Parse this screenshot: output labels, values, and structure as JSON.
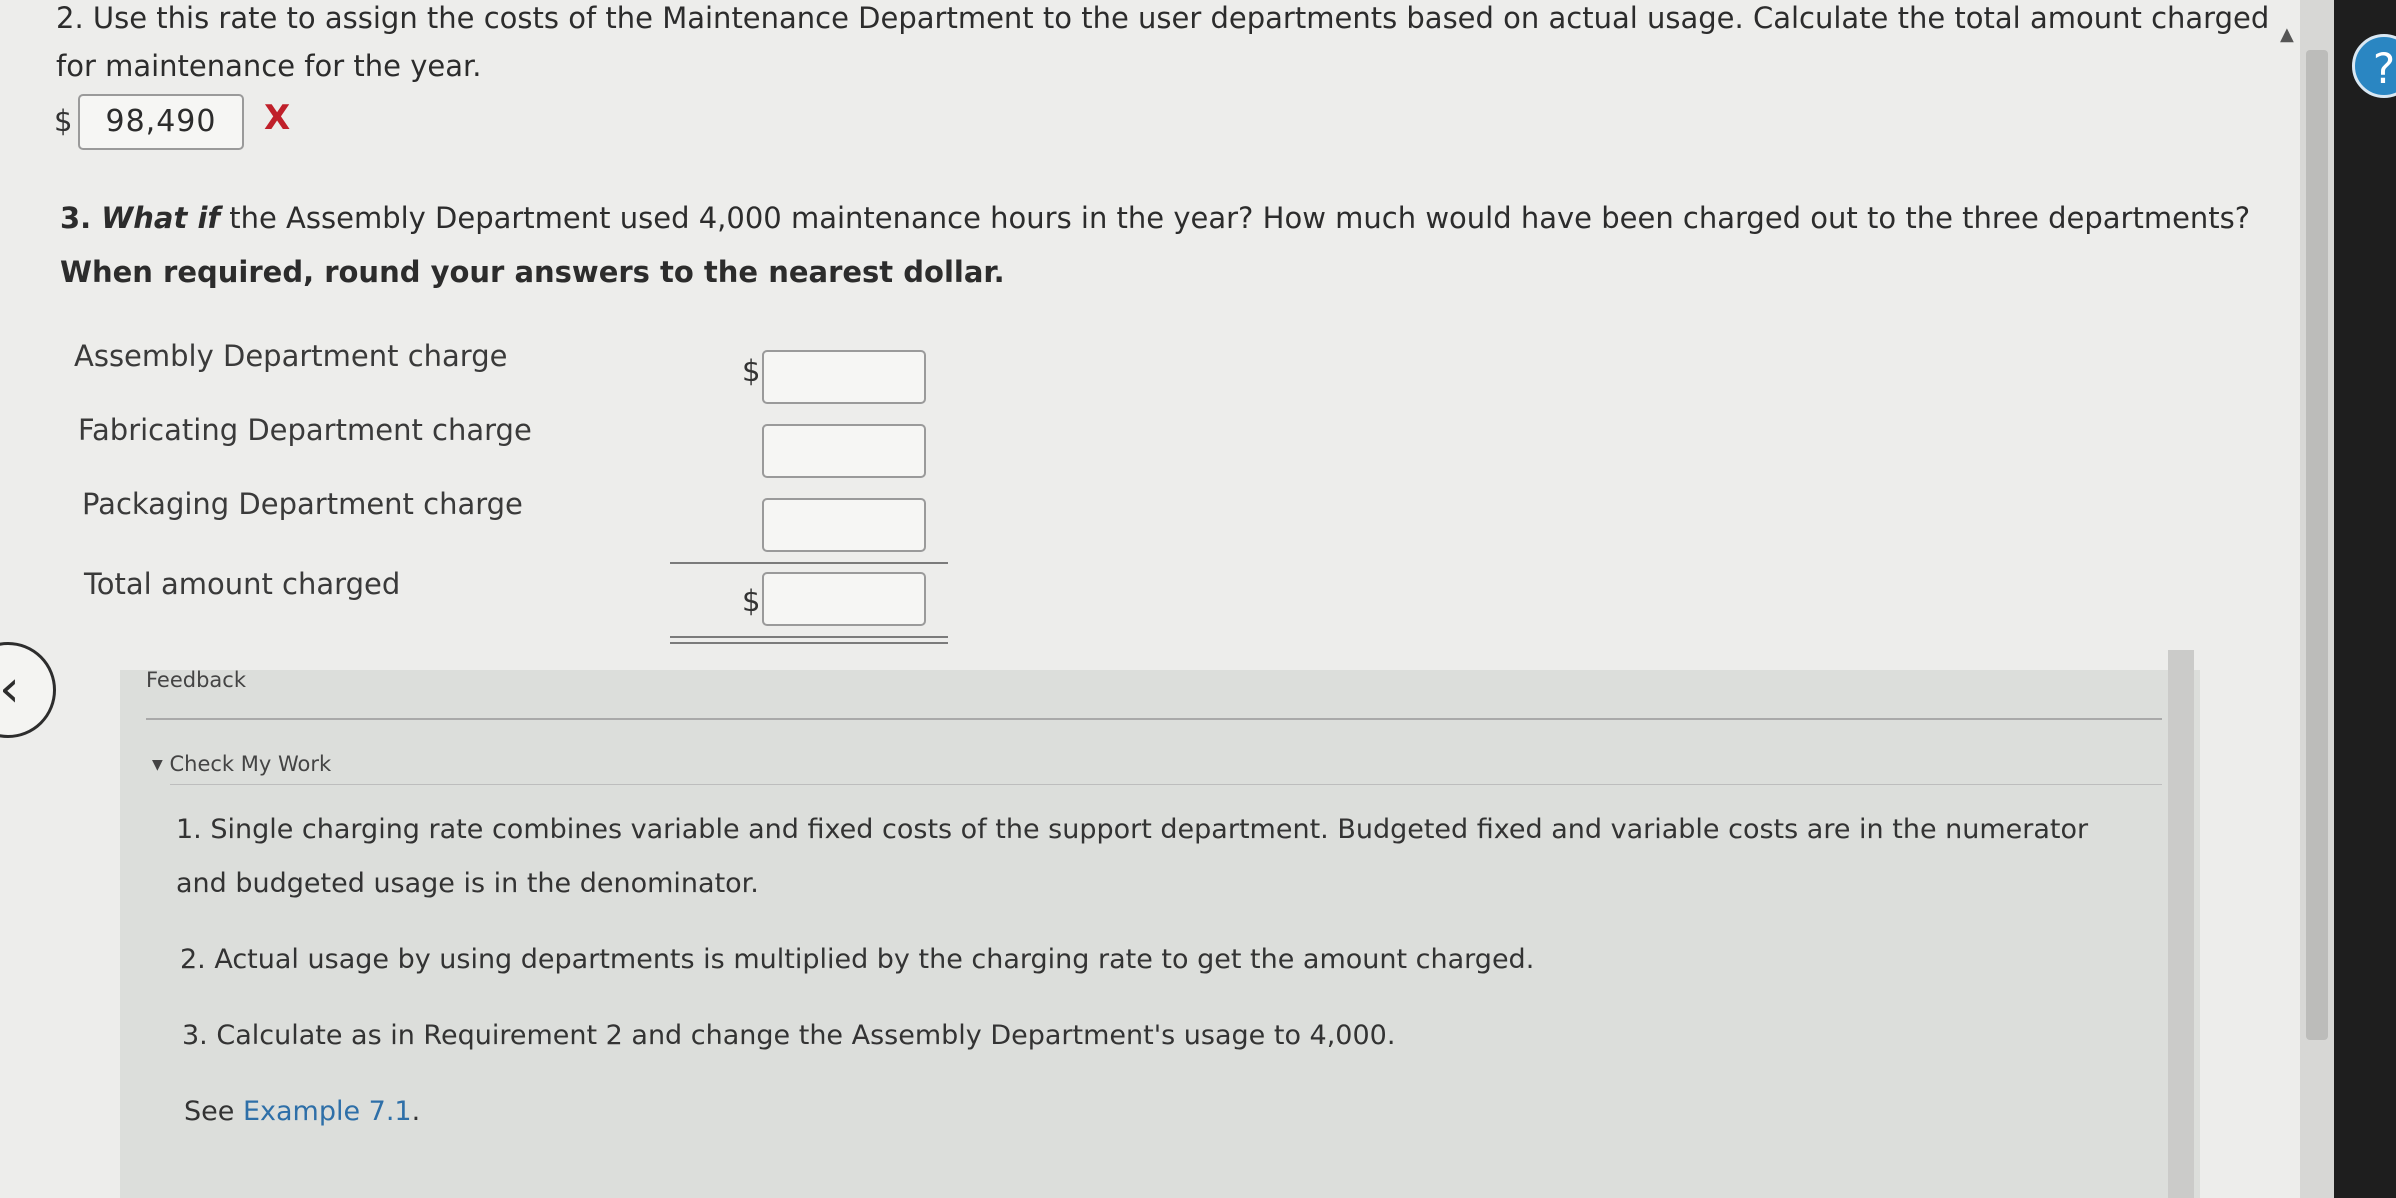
{
  "question2": {
    "line1": "2. Use this rate to assign the costs of the Maintenance Department to the user departments based on actual usage. Calculate the total amount charged",
    "line2": "for maintenance for the year.",
    "currency": "$",
    "answer_value": "98,490",
    "result_mark": "X"
  },
  "question3": {
    "line1_prefix": "3. ",
    "line1_emph": "What if",
    "line1_rest": " the Assembly Department used 4,000 maintenance hours in the year? How much would have been charged out to the three departments?",
    "instruction": "When required, round your answers to the nearest dollar.",
    "rows": [
      {
        "label": "Assembly Department charge",
        "currency": "$",
        "value": ""
      },
      {
        "label": "Fabricating Department charge",
        "currency": "",
        "value": ""
      },
      {
        "label": "Packaging Department charge",
        "currency": "",
        "value": ""
      },
      {
        "label": "Total amount charged",
        "currency": "$",
        "value": ""
      }
    ]
  },
  "feedback": {
    "title": "Feedback",
    "toggle_label": "Check My Work",
    "items": [
      "1. Single charging rate combines variable and fixed costs of the support department. Budgeted fixed and variable costs are in the numerator",
      "and budgeted usage is in the denominator.",
      "2. Actual usage by using departments is multiplied by the charging rate to get the amount charged.",
      "3. Calculate as in Requirement 2 and change the Assembly Department's usage to 4,000."
    ],
    "see_prefix": "See ",
    "see_link": "Example 7.1",
    "see_suffix": "."
  },
  "icons": {
    "back": "chevron-left-icon",
    "help": "help-icon",
    "toggle": "triangle-down-icon"
  },
  "colors": {
    "error": "#c0202a",
    "link": "#2e6fa8",
    "help_button": "#2a86c2"
  }
}
